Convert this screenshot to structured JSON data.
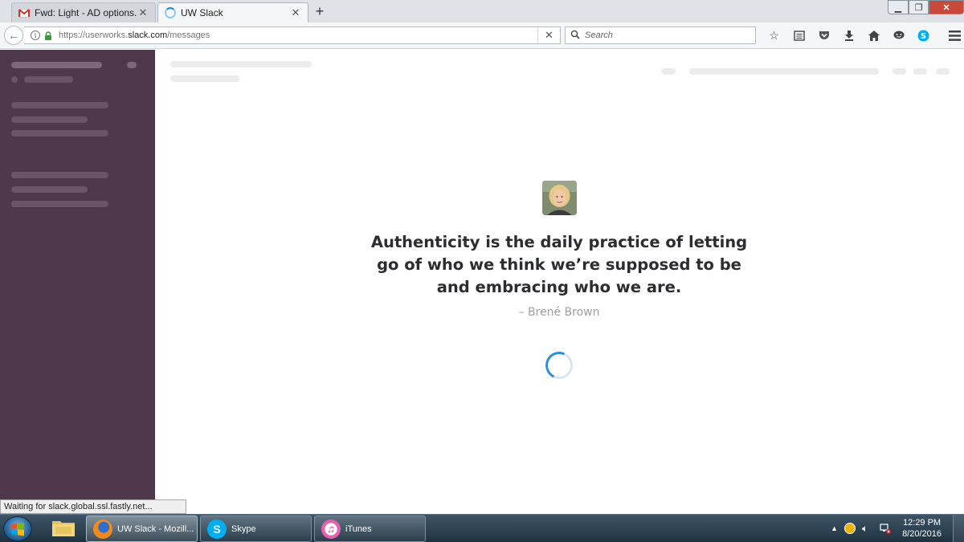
{
  "browser": {
    "tabs": [
      {
        "title": "Fwd: Light - AD options. - ...",
        "active": false
      },
      {
        "title": "UW Slack",
        "active": true
      }
    ],
    "new_tab_label": "+",
    "url_prefix": "https://userworks.",
    "url_domain": "slack.com",
    "url_path": "/messages",
    "search_placeholder": "Search",
    "status_text": "Waiting for slack.global.ssl.fastly.net..."
  },
  "loading_screen": {
    "quote": "Authenticity is the daily practice of letting go of who we think we’re supposed to be and embracing who we are.",
    "author": "– Brené Brown"
  },
  "taskbar": {
    "items": [
      {
        "label": "",
        "icon": "folder-icon"
      },
      {
        "label": "UW Slack - Mozill...",
        "icon": "firefox-icon",
        "active": true
      },
      {
        "label": "Skype",
        "icon": "skype-icon"
      },
      {
        "label": "iTunes",
        "icon": "itunes-icon"
      }
    ],
    "time": "12:29 PM",
    "date": "8/20/2016"
  },
  "colors": {
    "sidebar": "#4d394b",
    "quote_text": "#2c2d30",
    "author_text": "#a0a0a2",
    "spinner": "#2d8fd5"
  }
}
